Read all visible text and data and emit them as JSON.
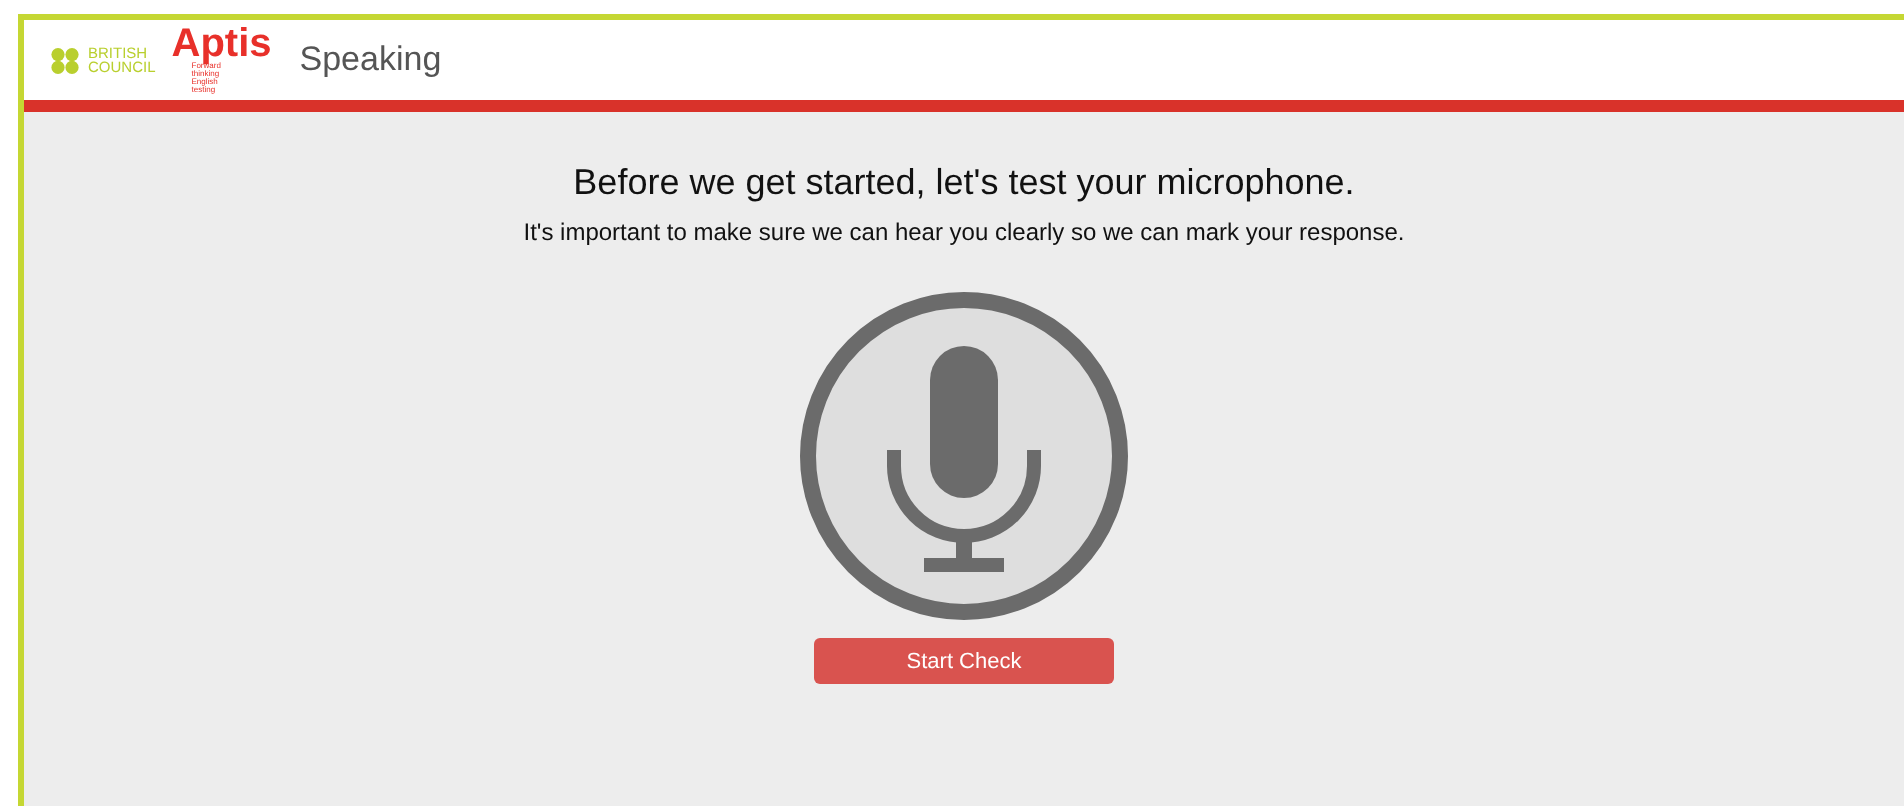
{
  "header": {
    "brand_lines": [
      "BRITISH",
      "COUNCIL"
    ],
    "product": "Aptis",
    "tagline": "Forward thinking English testing",
    "section": "Speaking"
  },
  "content": {
    "heading": "Before we get started, let's test your microphone.",
    "subheading": "It's important to make sure we can hear you clearly so we can mark your response.",
    "button": "Start Check"
  }
}
